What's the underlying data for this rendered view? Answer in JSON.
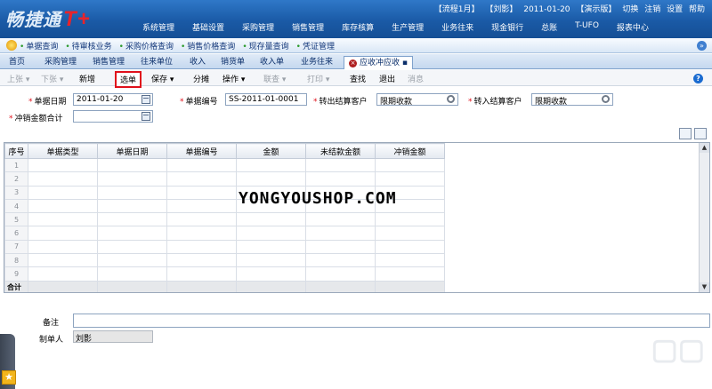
{
  "app": {
    "logo_text": "畅捷通",
    "logo_mark": "T+"
  },
  "status_bar": [
    "【流程1月】",
    "【刘影】",
    "2011-01-20",
    "【演示版】",
    "切换",
    "注销",
    "设置",
    "帮助"
  ],
  "main_menu": [
    "系统管理",
    "基础设置",
    "采购管理",
    "销售管理",
    "库存核算",
    "生产管理",
    "业务往来",
    "现金银行",
    "总账",
    "T-UFO",
    "报表中心"
  ],
  "quick_links": [
    "单据查询",
    "待审核业务",
    "采购价格查询",
    "销售价格查询",
    "现存量查询",
    "凭证管理"
  ],
  "tabs": [
    "首页",
    "采购管理",
    "销售管理",
    "往来单位",
    "收入",
    "销货单",
    "收入单",
    "业务往来",
    "应收冲应收"
  ],
  "toolbar": {
    "prev": "上张",
    "next": "下张",
    "new": "新增",
    "select": "选单",
    "save": "保存",
    "split": "分摊",
    "operate": "操作",
    "linked": "联查",
    "print": "打印",
    "find": "查找",
    "exit": "退出",
    "message": "消息"
  },
  "form": {
    "doc_date_label": "单据日期",
    "doc_date": "2011-01-20",
    "doc_no_label": "单据编号",
    "doc_no": "SS-2011-01-0001",
    "out_customer_label": "转出结算客户",
    "out_customer": "限期收款",
    "in_customer_label": "转入结算客户",
    "in_customer": "限期收款",
    "offset_total_label": "冲销金额合计",
    "offset_total": ""
  },
  "table": {
    "headers": [
      "序号",
      "单据类型",
      "单据日期",
      "单据编号",
      "金额",
      "未结款金额",
      "冲销金额"
    ],
    "row_numbers": [
      "1",
      "2",
      "3",
      "4",
      "5",
      "6",
      "7",
      "8",
      "9"
    ],
    "total_label": "合计"
  },
  "watermark": "YONGYOUSHOP.COM",
  "footer": {
    "remark_label": "备注",
    "maker_label": "制单人",
    "maker": "刘影"
  }
}
